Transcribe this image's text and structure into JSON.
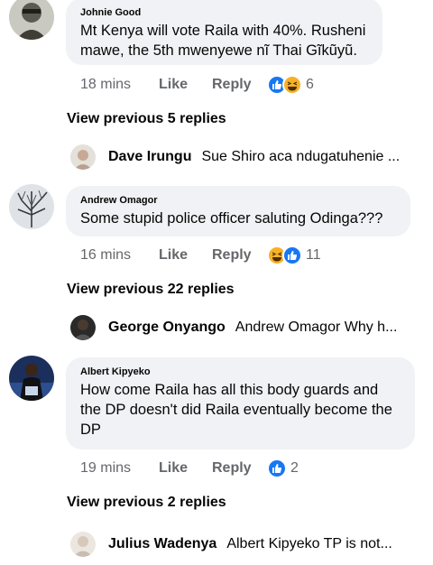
{
  "comments": [
    {
      "author": "Johnie Good",
      "text": "Mt Kenya will vote Raila with 40%. Rusheni mawe, the 5th mwenyewe nĩ Thai Gĩkũyũ.",
      "time": "18 mins",
      "like_label": "Like",
      "reply_label": "Reply",
      "reactions": [
        "like",
        "haha"
      ],
      "reaction_count": "6",
      "view_previous": "View previous 5 replies",
      "latest_reply": {
        "name": "Dave Irungu",
        "text": "Sue Shiro aca ndugatuhenie ..."
      }
    },
    {
      "author": "Andrew Omagor",
      "text": "Some stupid police officer saluting Odinga???",
      "time": "16 mins",
      "like_label": "Like",
      "reply_label": "Reply",
      "reactions": [
        "haha",
        "like"
      ],
      "reaction_count": "11",
      "view_previous": "View previous 22 replies",
      "latest_reply": {
        "name": "George Onyango",
        "text": "Andrew Omagor Why h..."
      }
    },
    {
      "author": "Albert Kipyeko",
      "text": "How come Raila has all this body guards and the DP doesn't did Raila eventually become the DP",
      "time": "19 mins",
      "like_label": "Like",
      "reply_label": "Reply",
      "reactions": [
        "like"
      ],
      "reaction_count": "2",
      "view_previous": "View previous 2 replies",
      "latest_reply": {
        "name": "Julius Wadenya",
        "text": "Albert Kipyeko TP is not..."
      }
    }
  ],
  "colors": {
    "like": "#1877f2",
    "haha": "#f7b125",
    "bubble": "#f0f2f5",
    "meta": "#65676b"
  }
}
